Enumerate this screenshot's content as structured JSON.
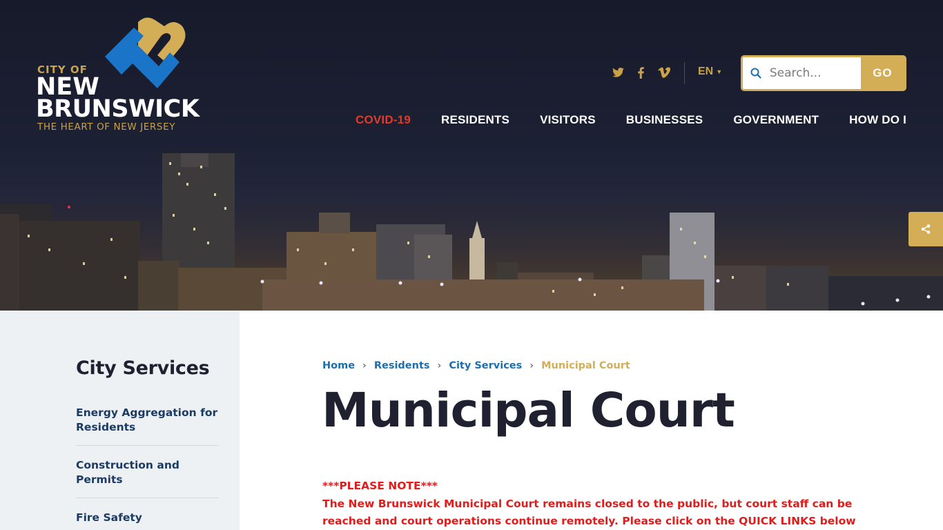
{
  "logo": {
    "city_of": "CITY OF",
    "new": "NEW",
    "brunswick": "BRUNSWICK",
    "tagline": "THE HEART OF NEW JERSEY"
  },
  "header": {
    "social": [
      {
        "icon": "twitter-icon"
      },
      {
        "icon": "facebook-icon"
      },
      {
        "icon": "vimeo-icon"
      }
    ],
    "language": "EN",
    "search": {
      "placeholder": "Search...",
      "button_label": "GO"
    },
    "nav": [
      {
        "label": "COVID-19",
        "alert": true
      },
      {
        "label": "RESIDENTS"
      },
      {
        "label": "VISITORS"
      },
      {
        "label": "BUSINESSES"
      },
      {
        "label": "GOVERNMENT"
      },
      {
        "label": "HOW DO I"
      }
    ]
  },
  "share": {
    "icon": "share-icon"
  },
  "sidebar": {
    "title": "City Services",
    "items": [
      {
        "label": "Energy Aggregation for Residents"
      },
      {
        "label": "Construction and Permits"
      },
      {
        "label": "Fire Safety"
      }
    ]
  },
  "breadcrumb": [
    {
      "label": "Home"
    },
    {
      "label": "Residents"
    },
    {
      "label": "City Services"
    },
    {
      "label": "Municipal Court"
    }
  ],
  "main": {
    "title": "Municipal Court",
    "notice_heading": "***PLEASE NOTE***",
    "notice_body": "The New Brunswick Municipal Court remains closed to the public, but court staff can be reached and court operations continue remotely.  Please click on the QUICK LINKS below for"
  },
  "colors": {
    "gold": "#d4ad57",
    "navy": "#1b3b63",
    "link_blue": "#1b6fb0",
    "alert_red": "#e21b1b",
    "logo_blue": "#1a74c8"
  }
}
